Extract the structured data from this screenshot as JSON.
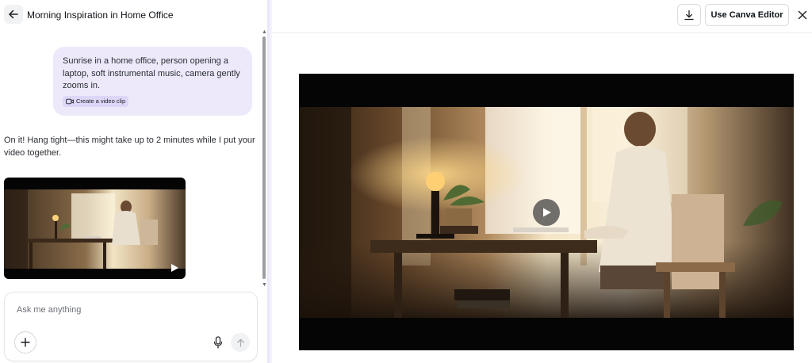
{
  "header": {
    "title": "Morning Inspiration in Home Office"
  },
  "chat": {
    "user_message": "Sunrise in a home office, person opening a laptop, soft instrumental music, camera gently zooms in.",
    "chip_label": "Create a video clip",
    "assistant_message": "On it! Hang tight—this might take up to 2 minutes while I put your video together."
  },
  "composer": {
    "placeholder": "Ask me anything"
  },
  "toolbar": {
    "editor_label": "Use Canva Editor"
  },
  "icons": {
    "back": "arrow-left-icon",
    "clip": "video-clip-icon",
    "play": "play-icon",
    "plus": "plus-icon",
    "mic": "microphone-icon",
    "send": "arrow-up-icon",
    "download": "download-icon",
    "close": "close-icon"
  },
  "colors": {
    "user_bubble": "#ede9fb",
    "chip": "#ddd6f7",
    "player_bg": "#050505"
  }
}
